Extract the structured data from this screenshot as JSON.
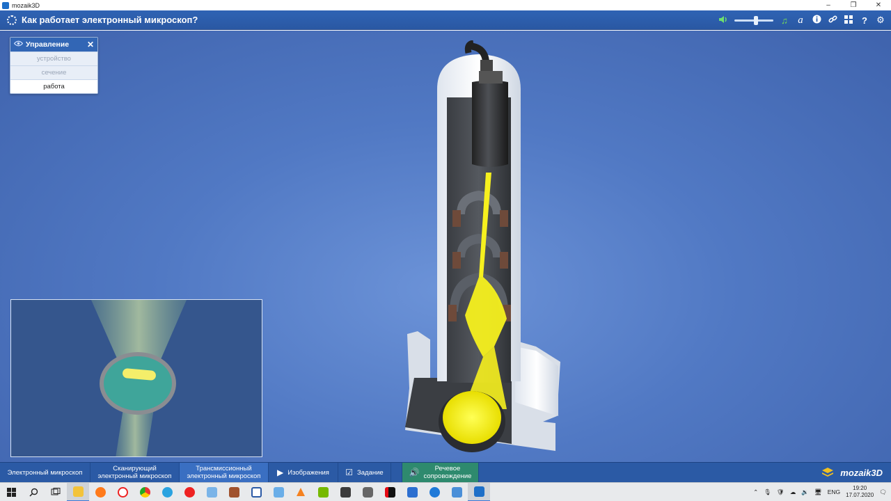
{
  "window": {
    "title": "mozaik3D",
    "controls": [
      "–",
      "❐",
      "✕"
    ]
  },
  "header": {
    "title": "Как работает электронный микроскоп?",
    "volume_level": 0.55,
    "icons": [
      "speaker-icon",
      "music-icon",
      "font-icon",
      "info-icon",
      "link-icon",
      "grid-icon",
      "help-icon",
      "settings-icon"
    ],
    "icon_glyphs": {
      "music": "♫",
      "font": "a",
      "info": "ℹ",
      "link": "🔗",
      "grid": "▦",
      "help": "?",
      "settings": "⚙"
    }
  },
  "control_panel": {
    "title": "Управление",
    "items": [
      {
        "label": "устройство",
        "active": false
      },
      {
        "label": "сечение",
        "active": false
      },
      {
        "label": "работа",
        "active": true
      }
    ]
  },
  "tabs": {
    "electron_microscope": "Электронный микроскоп",
    "scanning_l1": "Сканирующий",
    "scanning_l2": "электронный микроскоп",
    "transmission_l1": "Трансмиссионный",
    "transmission_l2": "электронный микроскоп",
    "images": "Изображения",
    "task": "Задание",
    "speech_l1": "Речевое",
    "speech_l2": "сопровождение",
    "brand": "mozaik3D"
  },
  "taskbar": {
    "lang": "ENG",
    "time": "19:20",
    "date": "17.07.2020"
  },
  "colors": {
    "header": "#2f63b4",
    "beam": "#f6f01e",
    "tab_active": "#3a6fc2",
    "speech_tab": "#2e8a6e"
  }
}
